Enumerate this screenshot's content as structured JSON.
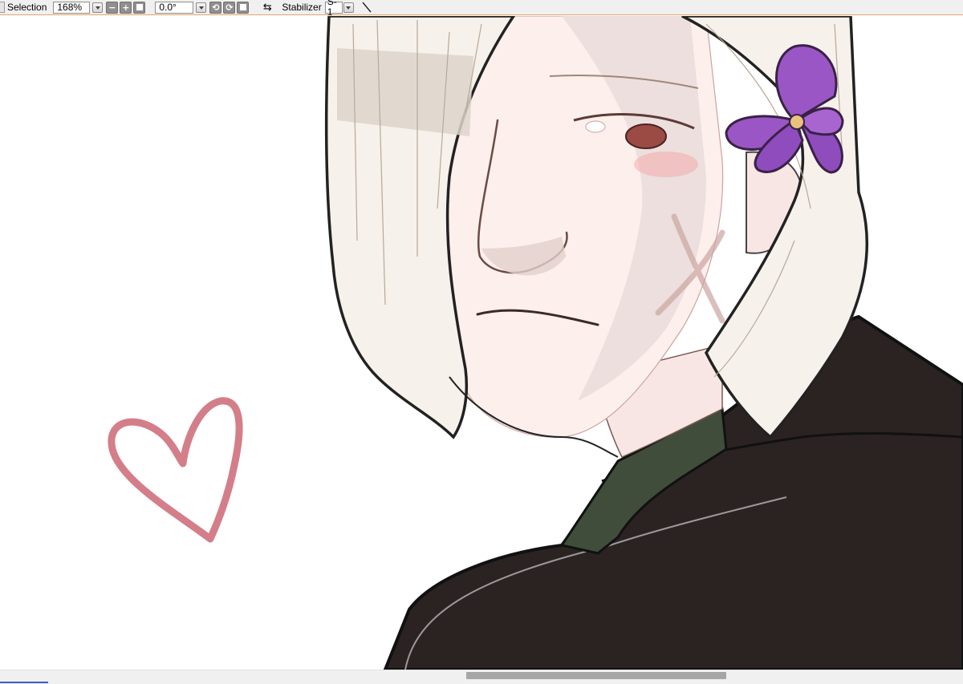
{
  "toolbar": {
    "selection_label": "Selection",
    "zoom_value": "168%",
    "rotation_value": "0.0°",
    "stabilizer_label": "Stabilizer",
    "stabilizer_value": "S-1"
  },
  "icons": {
    "zoom_out": "minus-icon",
    "zoom_in": "plus-icon",
    "zoom_reset": "square-icon",
    "rotate_left": "rotate-ccw-icon",
    "rotate_right": "rotate-cw-icon",
    "rotate_reset": "square-icon",
    "flip": "flip-horizontal-icon",
    "pen": "line-tool-icon"
  },
  "colors": {
    "toolbar_bg": "#f0f0f0",
    "toolbar_border": "#e8a26a",
    "heart": "#d07380",
    "flower": "#9a56c4",
    "coat": "#2b2322",
    "shirt": "#3f4d3a",
    "hair": "#f6f1ea",
    "skin": "#fcefec",
    "scrollbar_thumb": "#a6a6a6"
  },
  "scroll": {
    "position": 0.49,
    "visible_fraction": 0.27
  }
}
